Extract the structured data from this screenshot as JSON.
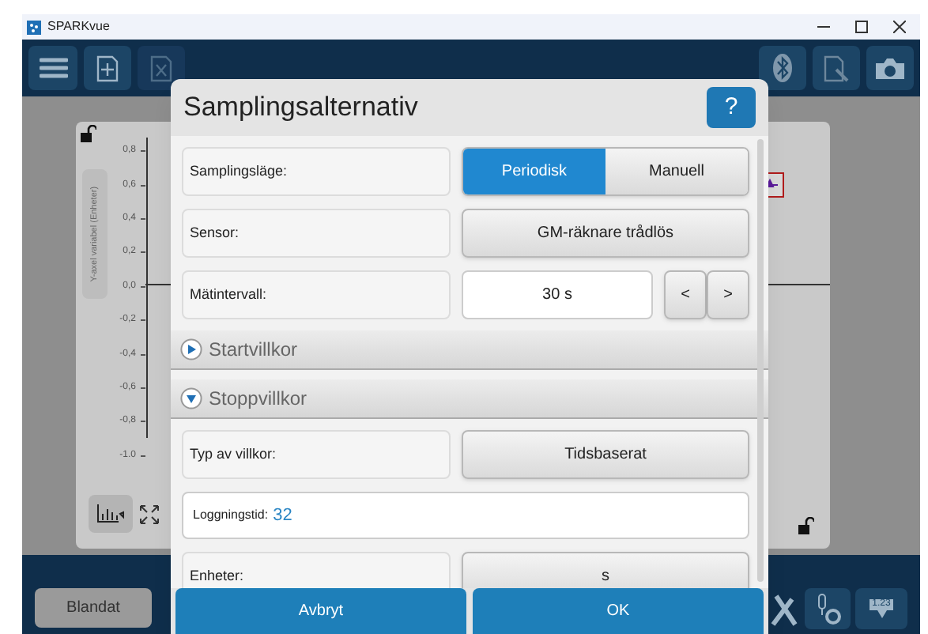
{
  "window": {
    "title": "SPARKvue"
  },
  "graph": {
    "axis_label": "Y-axel variabel (Enheter)",
    "y_tick_labels": [
      "0,8",
      "0,6",
      "0,4",
      "0,2",
      "0,0",
      "-0,2",
      "-0,4",
      "-0,6",
      "-0,8",
      "-1.0"
    ]
  },
  "bottom_bar": {
    "mode_button": "Blandat",
    "display_tool": "1.23"
  },
  "dialog": {
    "title": "Samplingsalternativ",
    "help": "?",
    "rows": [
      {
        "kind": "segmented",
        "label": "Samplingsläge:",
        "options": [
          {
            "label": "Periodisk",
            "selected": true
          },
          {
            "label": "Manuell",
            "selected": false
          }
        ]
      },
      {
        "kind": "button",
        "label": "Sensor:",
        "value": "GM-räknare trådlös"
      },
      {
        "kind": "stepper",
        "label": "Mätintervall:",
        "value": "30 s",
        "decrease": "<",
        "increase": ">"
      },
      {
        "kind": "section",
        "label": "Startvillkor",
        "expanded": false
      },
      {
        "kind": "section",
        "label": "Stoppvillkor",
        "expanded": true
      },
      {
        "kind": "button",
        "label": "Typ av villkor:",
        "value": "Tidsbaserat"
      },
      {
        "kind": "field",
        "label": "Loggningstid:",
        "value": "32"
      },
      {
        "kind": "button",
        "label": "Enheter:",
        "value": "s"
      }
    ],
    "buttons": [
      "Avbryt",
      "OK"
    ]
  }
}
